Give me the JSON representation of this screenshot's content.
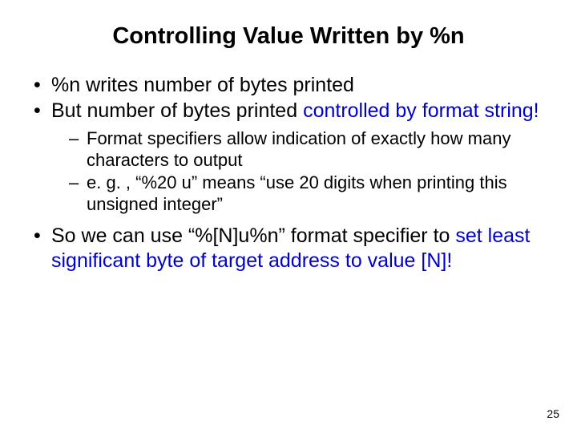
{
  "title": "Controlling Value Written by %n",
  "b1_part1": "%n writes number of bytes printed",
  "b2_part1": "But number of bytes printed ",
  "b2_blue": "controlled by format string!",
  "sub1": "Format specifiers allow indication of exactly how many characters to output",
  "sub2": "e. g. , “%20 u” means “use 20 digits when printing this unsigned integer”",
  "b3_part1": "So we can use “%[N]u%n” format specifier to ",
  "b3_blue": "set least significant byte of target address to value [N]!",
  "page_number": "25"
}
